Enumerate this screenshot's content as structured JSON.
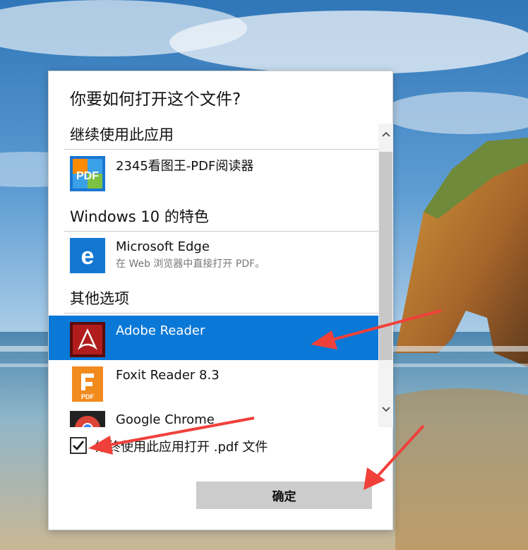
{
  "dialog": {
    "title": "你要如何打开这个文件?",
    "sections": [
      {
        "header": "继续使用此应用",
        "apps": [
          {
            "name": "2345看图王-PDF阅读器",
            "icon": "pdf-viewer-icon"
          }
        ]
      },
      {
        "header": "Windows 10 的特色",
        "apps": [
          {
            "name": "Microsoft Edge",
            "description": "在 Web 浏览器中直接打开 PDF。",
            "icon": "edge-icon"
          }
        ]
      },
      {
        "header": "其他选项",
        "apps": [
          {
            "name": "Adobe Reader",
            "icon": "adobe-reader-icon",
            "selected": true
          },
          {
            "name": "Foxit Reader 8.3",
            "icon": "foxit-reader-icon"
          },
          {
            "name": "Google Chrome",
            "icon": "chrome-icon"
          }
        ]
      }
    ],
    "always_use_checkbox": {
      "label": "始终使用此应用打开 .pdf 文件",
      "checked": true
    },
    "ok_button": "确定"
  },
  "colors": {
    "selected_row": "#0a78d7",
    "arrow": "#f0403a",
    "button": "#cccccc"
  }
}
